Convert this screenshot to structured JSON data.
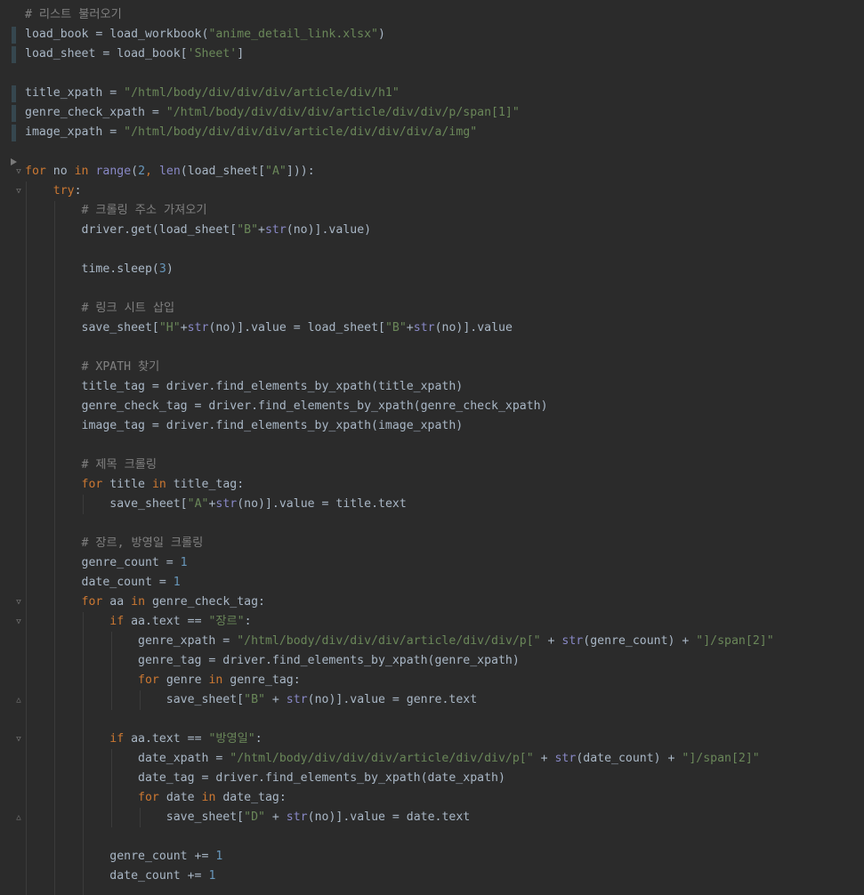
{
  "editor": {
    "language": "python",
    "lines": [
      [
        {
          "t": "# 리스트 불러오기",
          "c": "c"
        }
      ],
      [
        {
          "t": "load_book = load_workbook(",
          "c": ""
        },
        {
          "t": "\"anime_detail_link.xlsx\"",
          "c": "s"
        },
        {
          "t": ")",
          "c": ""
        }
      ],
      [
        {
          "t": "load_sheet = load_book[",
          "c": ""
        },
        {
          "t": "'Sheet'",
          "c": "s"
        },
        {
          "t": "]",
          "c": ""
        }
      ],
      [],
      [
        {
          "t": "title_xpath = ",
          "c": ""
        },
        {
          "t": "\"/html/body/div/div/div/article/div/h1\"",
          "c": "s"
        }
      ],
      [
        {
          "t": "genre_check_xpath = ",
          "c": ""
        },
        {
          "t": "\"/html/body/div/div/div/article/div/div/p/span[1]\"",
          "c": "s"
        }
      ],
      [
        {
          "t": "image_xpath = ",
          "c": ""
        },
        {
          "t": "\"/html/body/div/div/div/article/div/div/div/a/img\"",
          "c": "s"
        }
      ],
      [],
      [
        {
          "t": "for",
          "c": "k"
        },
        {
          "t": " no ",
          "c": ""
        },
        {
          "t": "in",
          "c": "k"
        },
        {
          "t": " ",
          "c": ""
        },
        {
          "t": "range",
          "c": "b"
        },
        {
          "t": "(",
          "c": ""
        },
        {
          "t": "2",
          "c": "n"
        },
        {
          "t": ", ",
          "c": "k"
        },
        {
          "t": "len",
          "c": "b"
        },
        {
          "t": "(load_sheet[",
          "c": ""
        },
        {
          "t": "\"A\"",
          "c": "s"
        },
        {
          "t": "])):",
          "c": ""
        }
      ],
      [
        {
          "t": "    ",
          "c": ""
        },
        {
          "t": "try",
          "c": "k"
        },
        {
          "t": ":",
          "c": ""
        }
      ],
      [
        {
          "t": "        ",
          "c": ""
        },
        {
          "t": "# 크롤링 주소 가져오기",
          "c": "c"
        }
      ],
      [
        {
          "t": "        driver.get(load_sheet[",
          "c": ""
        },
        {
          "t": "\"B\"",
          "c": "s"
        },
        {
          "t": "+",
          "c": ""
        },
        {
          "t": "str",
          "c": "b"
        },
        {
          "t": "(no)].value)",
          "c": ""
        }
      ],
      [],
      [
        {
          "t": "        time.sleep(",
          "c": ""
        },
        {
          "t": "3",
          "c": "n"
        },
        {
          "t": ")",
          "c": ""
        }
      ],
      [],
      [
        {
          "t": "        ",
          "c": ""
        },
        {
          "t": "# 링크 시트 삽입",
          "c": "c"
        }
      ],
      [
        {
          "t": "        save_sheet[",
          "c": ""
        },
        {
          "t": "\"H\"",
          "c": "s"
        },
        {
          "t": "+",
          "c": ""
        },
        {
          "t": "str",
          "c": "b"
        },
        {
          "t": "(no)].value = load_sheet[",
          "c": ""
        },
        {
          "t": "\"B\"",
          "c": "s"
        },
        {
          "t": "+",
          "c": ""
        },
        {
          "t": "str",
          "c": "b"
        },
        {
          "t": "(no)].value",
          "c": ""
        }
      ],
      [],
      [
        {
          "t": "        ",
          "c": ""
        },
        {
          "t": "# XPATH 찾기",
          "c": "c"
        }
      ],
      [
        {
          "t": "        title_tag = driver.find_elements_by_xpath(title_xpath)",
          "c": ""
        }
      ],
      [
        {
          "t": "        genre_check_tag = driver.find_elements_by_xpath(genre_check_xpath)",
          "c": ""
        }
      ],
      [
        {
          "t": "        image_tag = driver.find_elements_by_xpath(image_xpath)",
          "c": ""
        }
      ],
      [],
      [
        {
          "t": "        ",
          "c": ""
        },
        {
          "t": "# 제목 크롤링",
          "c": "c"
        }
      ],
      [
        {
          "t": "        ",
          "c": ""
        },
        {
          "t": "for",
          "c": "k"
        },
        {
          "t": " title ",
          "c": ""
        },
        {
          "t": "in",
          "c": "k"
        },
        {
          "t": " title_tag:",
          "c": ""
        }
      ],
      [
        {
          "t": "            save_sheet[",
          "c": ""
        },
        {
          "t": "\"A\"",
          "c": "s"
        },
        {
          "t": "+",
          "c": ""
        },
        {
          "t": "str",
          "c": "b"
        },
        {
          "t": "(no)].value = title.text",
          "c": ""
        }
      ],
      [],
      [
        {
          "t": "        ",
          "c": ""
        },
        {
          "t": "# 장르, 방영일 크롤링",
          "c": "c"
        }
      ],
      [
        {
          "t": "        genre_count = ",
          "c": ""
        },
        {
          "t": "1",
          "c": "n"
        }
      ],
      [
        {
          "t": "        date_count = ",
          "c": ""
        },
        {
          "t": "1",
          "c": "n"
        }
      ],
      [
        {
          "t": "        ",
          "c": ""
        },
        {
          "t": "for",
          "c": "k"
        },
        {
          "t": " aa ",
          "c": ""
        },
        {
          "t": "in",
          "c": "k"
        },
        {
          "t": " genre_check_tag:",
          "c": ""
        }
      ],
      [
        {
          "t": "            ",
          "c": ""
        },
        {
          "t": "if",
          "c": "k"
        },
        {
          "t": " aa.text == ",
          "c": ""
        },
        {
          "t": "\"장르\"",
          "c": "s"
        },
        {
          "t": ":",
          "c": ""
        }
      ],
      [
        {
          "t": "                genre_xpath = ",
          "c": ""
        },
        {
          "t": "\"/html/body/div/div/div/article/div/div/p[\"",
          "c": "s"
        },
        {
          "t": " + ",
          "c": ""
        },
        {
          "t": "str",
          "c": "b"
        },
        {
          "t": "(genre_count) + ",
          "c": ""
        },
        {
          "t": "\"]/span[2]\"",
          "c": "s"
        }
      ],
      [
        {
          "t": "                genre_tag = driver.find_elements_by_xpath(genre_xpath)",
          "c": ""
        }
      ],
      [
        {
          "t": "                ",
          "c": ""
        },
        {
          "t": "for",
          "c": "k"
        },
        {
          "t": " genre ",
          "c": ""
        },
        {
          "t": "in",
          "c": "k"
        },
        {
          "t": " genre_tag:",
          "c": ""
        }
      ],
      [
        {
          "t": "                    save_sheet[",
          "c": ""
        },
        {
          "t": "\"B\"",
          "c": "s"
        },
        {
          "t": " + ",
          "c": ""
        },
        {
          "t": "str",
          "c": "b"
        },
        {
          "t": "(no)].value = genre.text",
          "c": ""
        }
      ],
      [],
      [
        {
          "t": "            ",
          "c": ""
        },
        {
          "t": "if",
          "c": "k"
        },
        {
          "t": " aa.text == ",
          "c": ""
        },
        {
          "t": "\"방영일\"",
          "c": "s"
        },
        {
          "t": ":",
          "c": ""
        }
      ],
      [
        {
          "t": "                date_xpath = ",
          "c": ""
        },
        {
          "t": "\"/html/body/div/div/div/article/div/div/p[\"",
          "c": "s"
        },
        {
          "t": " + ",
          "c": ""
        },
        {
          "t": "str",
          "c": "b"
        },
        {
          "t": "(date_count) + ",
          "c": ""
        },
        {
          "t": "\"]/span[2]\"",
          "c": "s"
        }
      ],
      [
        {
          "t": "                date_tag = driver.find_elements_by_xpath(date_xpath)",
          "c": ""
        }
      ],
      [
        {
          "t": "                ",
          "c": ""
        },
        {
          "t": "for",
          "c": "k"
        },
        {
          "t": " date ",
          "c": ""
        },
        {
          "t": "in",
          "c": "k"
        },
        {
          "t": " date_tag:",
          "c": ""
        }
      ],
      [
        {
          "t": "                    save_sheet[",
          "c": ""
        },
        {
          "t": "\"D\"",
          "c": "s"
        },
        {
          "t": " + ",
          "c": ""
        },
        {
          "t": "str",
          "c": "b"
        },
        {
          "t": "(no)].value = date.text",
          "c": ""
        }
      ],
      [],
      [
        {
          "t": "            genre_count += ",
          "c": ""
        },
        {
          "t": "1",
          "c": "n"
        }
      ],
      [
        {
          "t": "            date_count += ",
          "c": ""
        },
        {
          "t": "1",
          "c": "n"
        }
      ]
    ]
  }
}
